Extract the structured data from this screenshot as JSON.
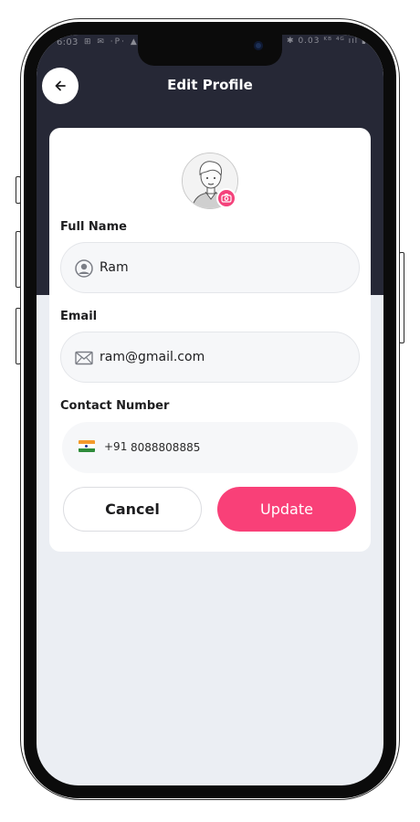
{
  "status_bar": {
    "time": "6:03",
    "left_icons": "⊞ ✉ ·P· ▲",
    "right_icons": "▮ ✱ 0.03 ᴷᴮ ⁴ᴳ ııl ▮"
  },
  "header": {
    "title": "Edit Profile",
    "back_icon": "arrow-left-icon"
  },
  "profile": {
    "avatar": "avatar-illustration",
    "camera_icon": "camera-icon"
  },
  "form": {
    "full_name": {
      "label": "Full Name",
      "value": "Ram",
      "icon": "user-circle-icon"
    },
    "email": {
      "label": "Email",
      "value": "ram@gmail.com",
      "icon": "envelope-icon"
    },
    "contact": {
      "label": "Contact Number",
      "flag": "india-flag-icon",
      "country_code": "+91",
      "number": "8088808885"
    }
  },
  "actions": {
    "cancel_label": "Cancel",
    "update_label": "Update"
  },
  "colors": {
    "header_bg": "#262836",
    "accent": "#f94078",
    "screen_bg": "#ebeef3"
  }
}
